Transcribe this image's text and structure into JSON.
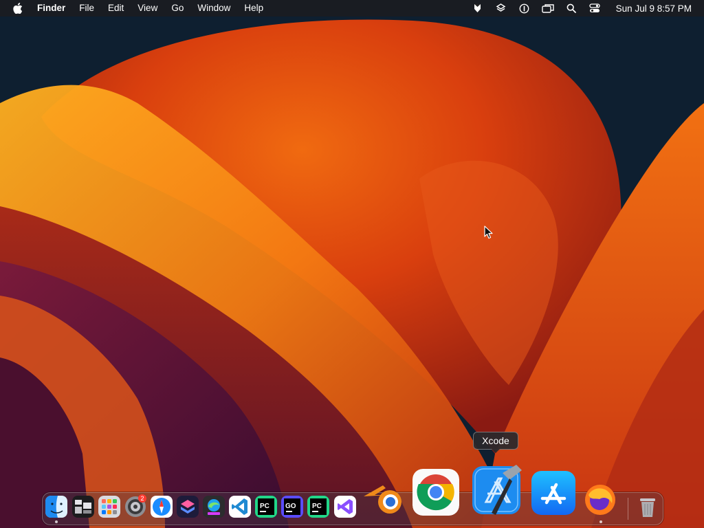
{
  "menubar": {
    "apple_icon": "apple-logo-icon",
    "app_name": "Finder",
    "menus": [
      "File",
      "Edit",
      "View",
      "Go",
      "Window",
      "Help"
    ],
    "status_icons": [
      "dropbox-icon",
      "layers-icon",
      "accessibility-icon",
      "screens-icon",
      "search-icon",
      "control-center-icon"
    ],
    "clock": "Sun Jul 9  8:57 PM"
  },
  "dock": {
    "apps": [
      "Finder",
      "Activity Monitor",
      "Launchpad",
      "System Settings",
      "Safari",
      "Shortcuts",
      "Edge Preview",
      "Visual Studio Code",
      "PyCharm",
      "GoLand",
      "PyCharm",
      "Visual Studio",
      "Blender",
      "Google Chrome",
      "Xcode",
      "App Store",
      "Firefox",
      "Trash"
    ],
    "settings_badge": "2",
    "hovered_app": "Xcode"
  },
  "tooltip": {
    "text": "Xcode"
  },
  "colors": {
    "accent": "#ff8c00",
    "menubar": "#1c1c20"
  }
}
